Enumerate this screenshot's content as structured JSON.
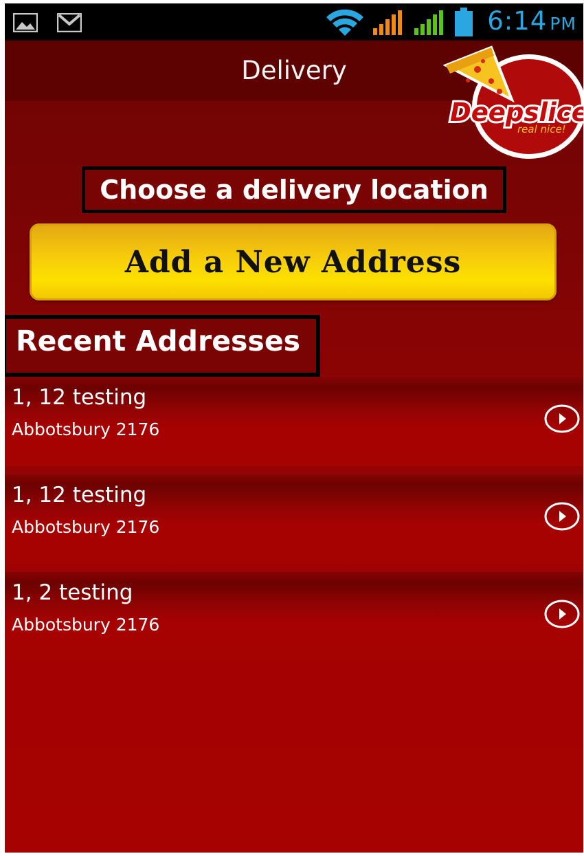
{
  "status_bar": {
    "time": "6:14",
    "ampm": "PM",
    "icons": [
      "image-icon",
      "gmail-icon",
      "wifi-icon",
      "signal-icon",
      "signal-icon",
      "battery-icon"
    ]
  },
  "header": {
    "title": "Delivery",
    "logo_text": "Deepslice",
    "logo_tagline": "real nice!"
  },
  "main": {
    "choose_heading": "Choose a delivery location",
    "add_button_label": "Add a New Address",
    "recent_heading": "Recent Addresses",
    "addresses": [
      {
        "line1": "1, 12 testing",
        "line2": "Abbotsbury 2176"
      },
      {
        "line1": "1, 12 testing",
        "line2": "Abbotsbury 2176"
      },
      {
        "line1": "1, 2 testing",
        "line2": "Abbotsbury 2176"
      }
    ]
  },
  "colors": {
    "background_red": "#a30202",
    "title_bar": "#5d0101",
    "button_yellow": "#fde000",
    "status_time": "#2aa7e0"
  }
}
